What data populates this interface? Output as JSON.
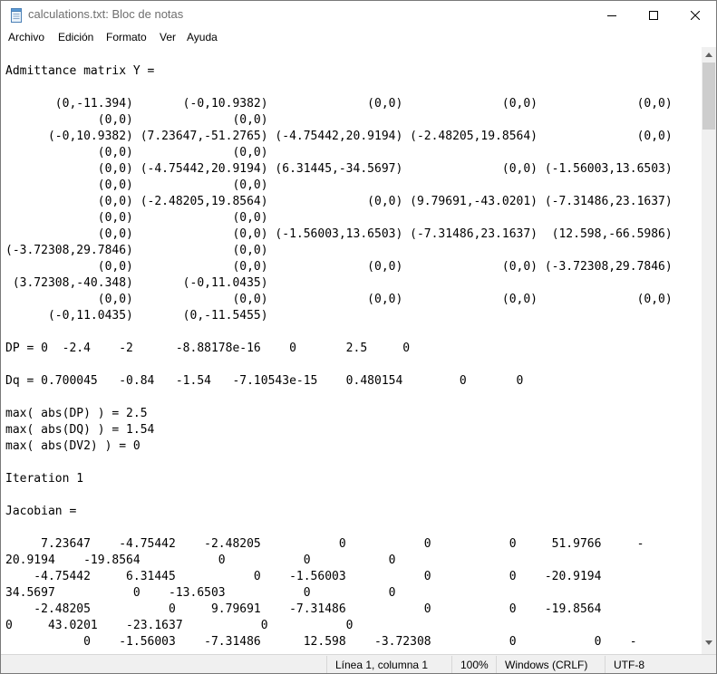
{
  "window": {
    "title": "calculations.txt: Bloc de notas",
    "app_icon": "notepad-icon",
    "controls": {
      "minimize": "minimize-icon",
      "maximize": "maximize-icon",
      "close": "close-icon"
    }
  },
  "menu": {
    "items": [
      "Archivo",
      "Edición",
      "Formato",
      "Ver",
      "Ayuda"
    ]
  },
  "editor": {
    "text": "Admittance matrix Y =\n\n       (0,-11.394)       (-0,10.9382)              (0,0)              (0,0)              (0,0)\n             (0,0)              (0,0)\n      (-0,10.9382) (7.23647,-51.2765) (-4.75442,20.9194) (-2.48205,19.8564)              (0,0)\n             (0,0)              (0,0)\n             (0,0) (-4.75442,20.9194) (6.31445,-34.5697)              (0,0) (-1.56003,13.6503)\n             (0,0)              (0,0)\n             (0,0) (-2.48205,19.8564)              (0,0) (9.79691,-43.0201) (-7.31486,23.1637)\n             (0,0)              (0,0)\n             (0,0)              (0,0) (-1.56003,13.6503) (-7.31486,23.1637)  (12.598,-66.5986)\n(-3.72308,29.7846)              (0,0)\n             (0,0)              (0,0)              (0,0)              (0,0) (-3.72308,29.7846)\n (3.72308,-40.348)       (-0,11.0435)\n             (0,0)              (0,0)              (0,0)              (0,0)              (0,0)\n      (-0,11.0435)       (0,-11.5455)\n\nDP = 0  -2.4    -2      -8.88178e-16    0       2.5     0\n\nDq = 0.700045   -0.84   -1.54   -7.10543e-15    0.480154        0       0\n\nmax( abs(DP) ) = 2.5\nmax( abs(DQ) ) = 1.54\nmax( abs(DV2) ) = 0\n\nIteration 1\n\nJacobian =\n\n     7.23647    -4.75442    -2.48205           0           0           0     51.9766     -\n20.9194    -19.8564           0           0           0\n    -4.75442     6.31445           0    -1.56003           0           0    -20.9194\n34.5697           0    -13.6503           0           0\n    -2.48205           0     9.79691    -7.31486           0           0    -19.8564\n0     43.0201    -23.1637           0           0\n           0    -1.56003    -7.31486      12.598    -3.72308           0           0    -"
  },
  "scrollbar": {
    "up": "scroll-up-arrow-icon",
    "down": "scroll-down-arrow-icon"
  },
  "status": {
    "position": "Línea 1, columna 1",
    "zoom": "100%",
    "line_endings": "Windows (CRLF)",
    "encoding": "UTF-8"
  }
}
